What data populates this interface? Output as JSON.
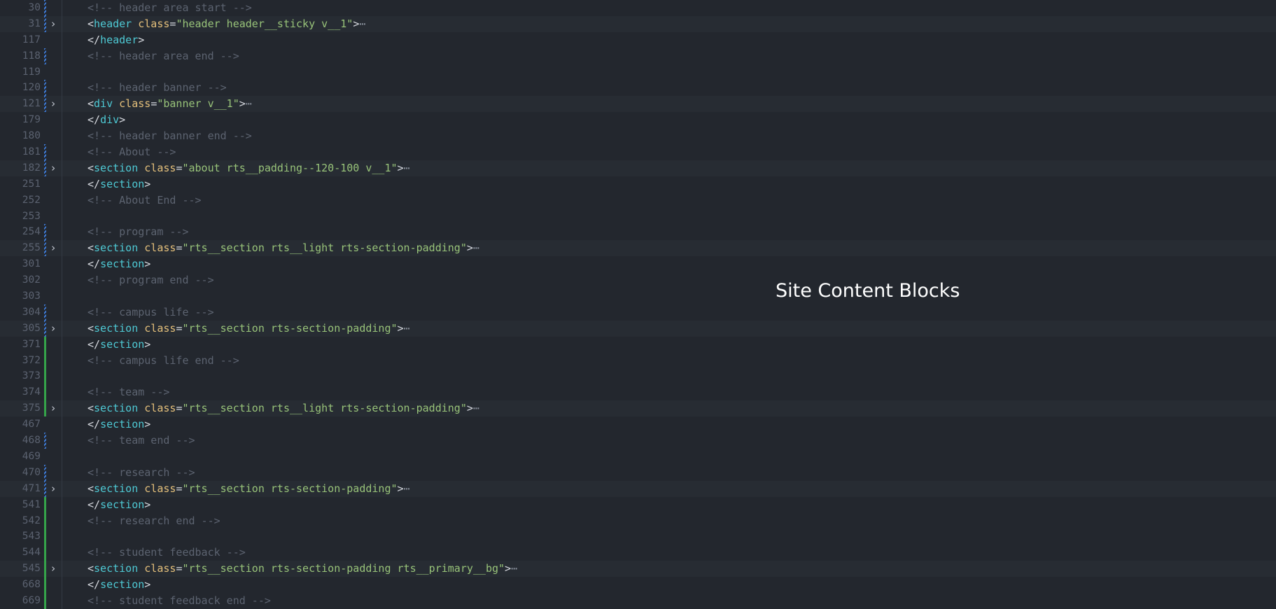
{
  "overlay_title": "Site Content Blocks",
  "lines": [
    {
      "no": "30",
      "kind": "comment",
      "text": "<!-- header area start -->",
      "gutter": "mod"
    },
    {
      "no": "31",
      "kind": "open",
      "tag": "header",
      "attr": "class",
      "value": "\"header header__sticky v__1\"",
      "folded": true,
      "gutter": "mod"
    },
    {
      "no": "117",
      "kind": "close",
      "tag": "header",
      "gutter": "none"
    },
    {
      "no": "118",
      "kind": "comment",
      "text": "<!-- header area end -->",
      "gutter": "mod"
    },
    {
      "no": "119",
      "kind": "blank",
      "gutter": "none"
    },
    {
      "no": "120",
      "kind": "comment",
      "text": "<!-- header banner -->",
      "gutter": "mod"
    },
    {
      "no": "121",
      "kind": "open",
      "tag": "div",
      "attr": "class",
      "value": "\"banner v__1\"",
      "folded": true,
      "gutter": "mod"
    },
    {
      "no": "179",
      "kind": "close",
      "tag": "div",
      "gutter": "none"
    },
    {
      "no": "180",
      "kind": "comment",
      "text": "<!-- header banner end -->",
      "gutter": "none"
    },
    {
      "no": "181",
      "kind": "comment",
      "text": "<!-- About -->",
      "gutter": "mod"
    },
    {
      "no": "182",
      "kind": "open",
      "tag": "section",
      "attr": "class",
      "value": "\"about rts__padding--120-100 v__1\"",
      "folded": true,
      "gutter": "mod"
    },
    {
      "no": "251",
      "kind": "close",
      "tag": "section",
      "gutter": "none"
    },
    {
      "no": "252",
      "kind": "comment",
      "text": "<!-- About End -->",
      "gutter": "none"
    },
    {
      "no": "253",
      "kind": "blank",
      "gutter": "none"
    },
    {
      "no": "254",
      "kind": "comment",
      "text": "<!-- program -->",
      "gutter": "mod"
    },
    {
      "no": "255",
      "kind": "open",
      "tag": "section",
      "attr": "class",
      "value": "\"rts__section rts__light rts-section-padding\"",
      "folded": true,
      "gutter": "mod"
    },
    {
      "no": "301",
      "kind": "close",
      "tag": "section",
      "gutter": "none"
    },
    {
      "no": "302",
      "kind": "comment",
      "text": "<!-- program end -->",
      "gutter": "none"
    },
    {
      "no": "303",
      "kind": "blank",
      "gutter": "none"
    },
    {
      "no": "304",
      "kind": "comment",
      "text": "<!-- campus life -->",
      "gutter": "mod"
    },
    {
      "no": "305",
      "kind": "open",
      "tag": "section",
      "attr": "class",
      "value": "\"rts__section rts-section-padding\"",
      "folded": true,
      "gutter": "mod"
    },
    {
      "no": "371",
      "kind": "close",
      "tag": "section",
      "gutter": "add"
    },
    {
      "no": "372",
      "kind": "comment",
      "text": "<!-- campus life end -->",
      "gutter": "add"
    },
    {
      "no": "373",
      "kind": "blank",
      "gutter": "add"
    },
    {
      "no": "374",
      "kind": "comment",
      "text": "<!-- team -->",
      "gutter": "add"
    },
    {
      "no": "375",
      "kind": "open",
      "tag": "section",
      "attr": "class",
      "value": "\"rts__section rts__light rts-section-padding\"",
      "folded": true,
      "gutter": "add"
    },
    {
      "no": "467",
      "kind": "close",
      "tag": "section",
      "gutter": "none"
    },
    {
      "no": "468",
      "kind": "comment",
      "text": "<!-- team end -->",
      "gutter": "mod"
    },
    {
      "no": "469",
      "kind": "blank",
      "gutter": "none"
    },
    {
      "no": "470",
      "kind": "comment",
      "text": "<!-- research -->",
      "gutter": "mod"
    },
    {
      "no": "471",
      "kind": "open",
      "tag": "section",
      "attr": "class",
      "value": "\"rts__section rts-section-padding\"",
      "folded": true,
      "gutter": "mod"
    },
    {
      "no": "541",
      "kind": "close",
      "tag": "section",
      "gutter": "add"
    },
    {
      "no": "542",
      "kind": "comment",
      "text": "<!-- research end -->",
      "gutter": "add"
    },
    {
      "no": "543",
      "kind": "blank",
      "gutter": "add"
    },
    {
      "no": "544",
      "kind": "comment",
      "text": "<!-- student feedback -->",
      "gutter": "add"
    },
    {
      "no": "545",
      "kind": "open",
      "tag": "section",
      "attr": "class",
      "value": "\"rts__section rts-section-padding rts__primary__bg\"",
      "folded": true,
      "gutter": "add"
    },
    {
      "no": "668",
      "kind": "close",
      "tag": "section",
      "gutter": "add"
    },
    {
      "no": "669",
      "kind": "comment",
      "text": "<!-- student feedback end -->",
      "gutter": "add"
    }
  ],
  "glyphs": {
    "fold": "›",
    "ellipsis": "⋯"
  },
  "colors": {
    "background": "#23272e",
    "tag": "#4ec9d4",
    "attribute": "#e5c07b",
    "string": "#98c379",
    "comment": "#5c6370",
    "modified": "#3d7ad6",
    "added": "#35a44a"
  }
}
